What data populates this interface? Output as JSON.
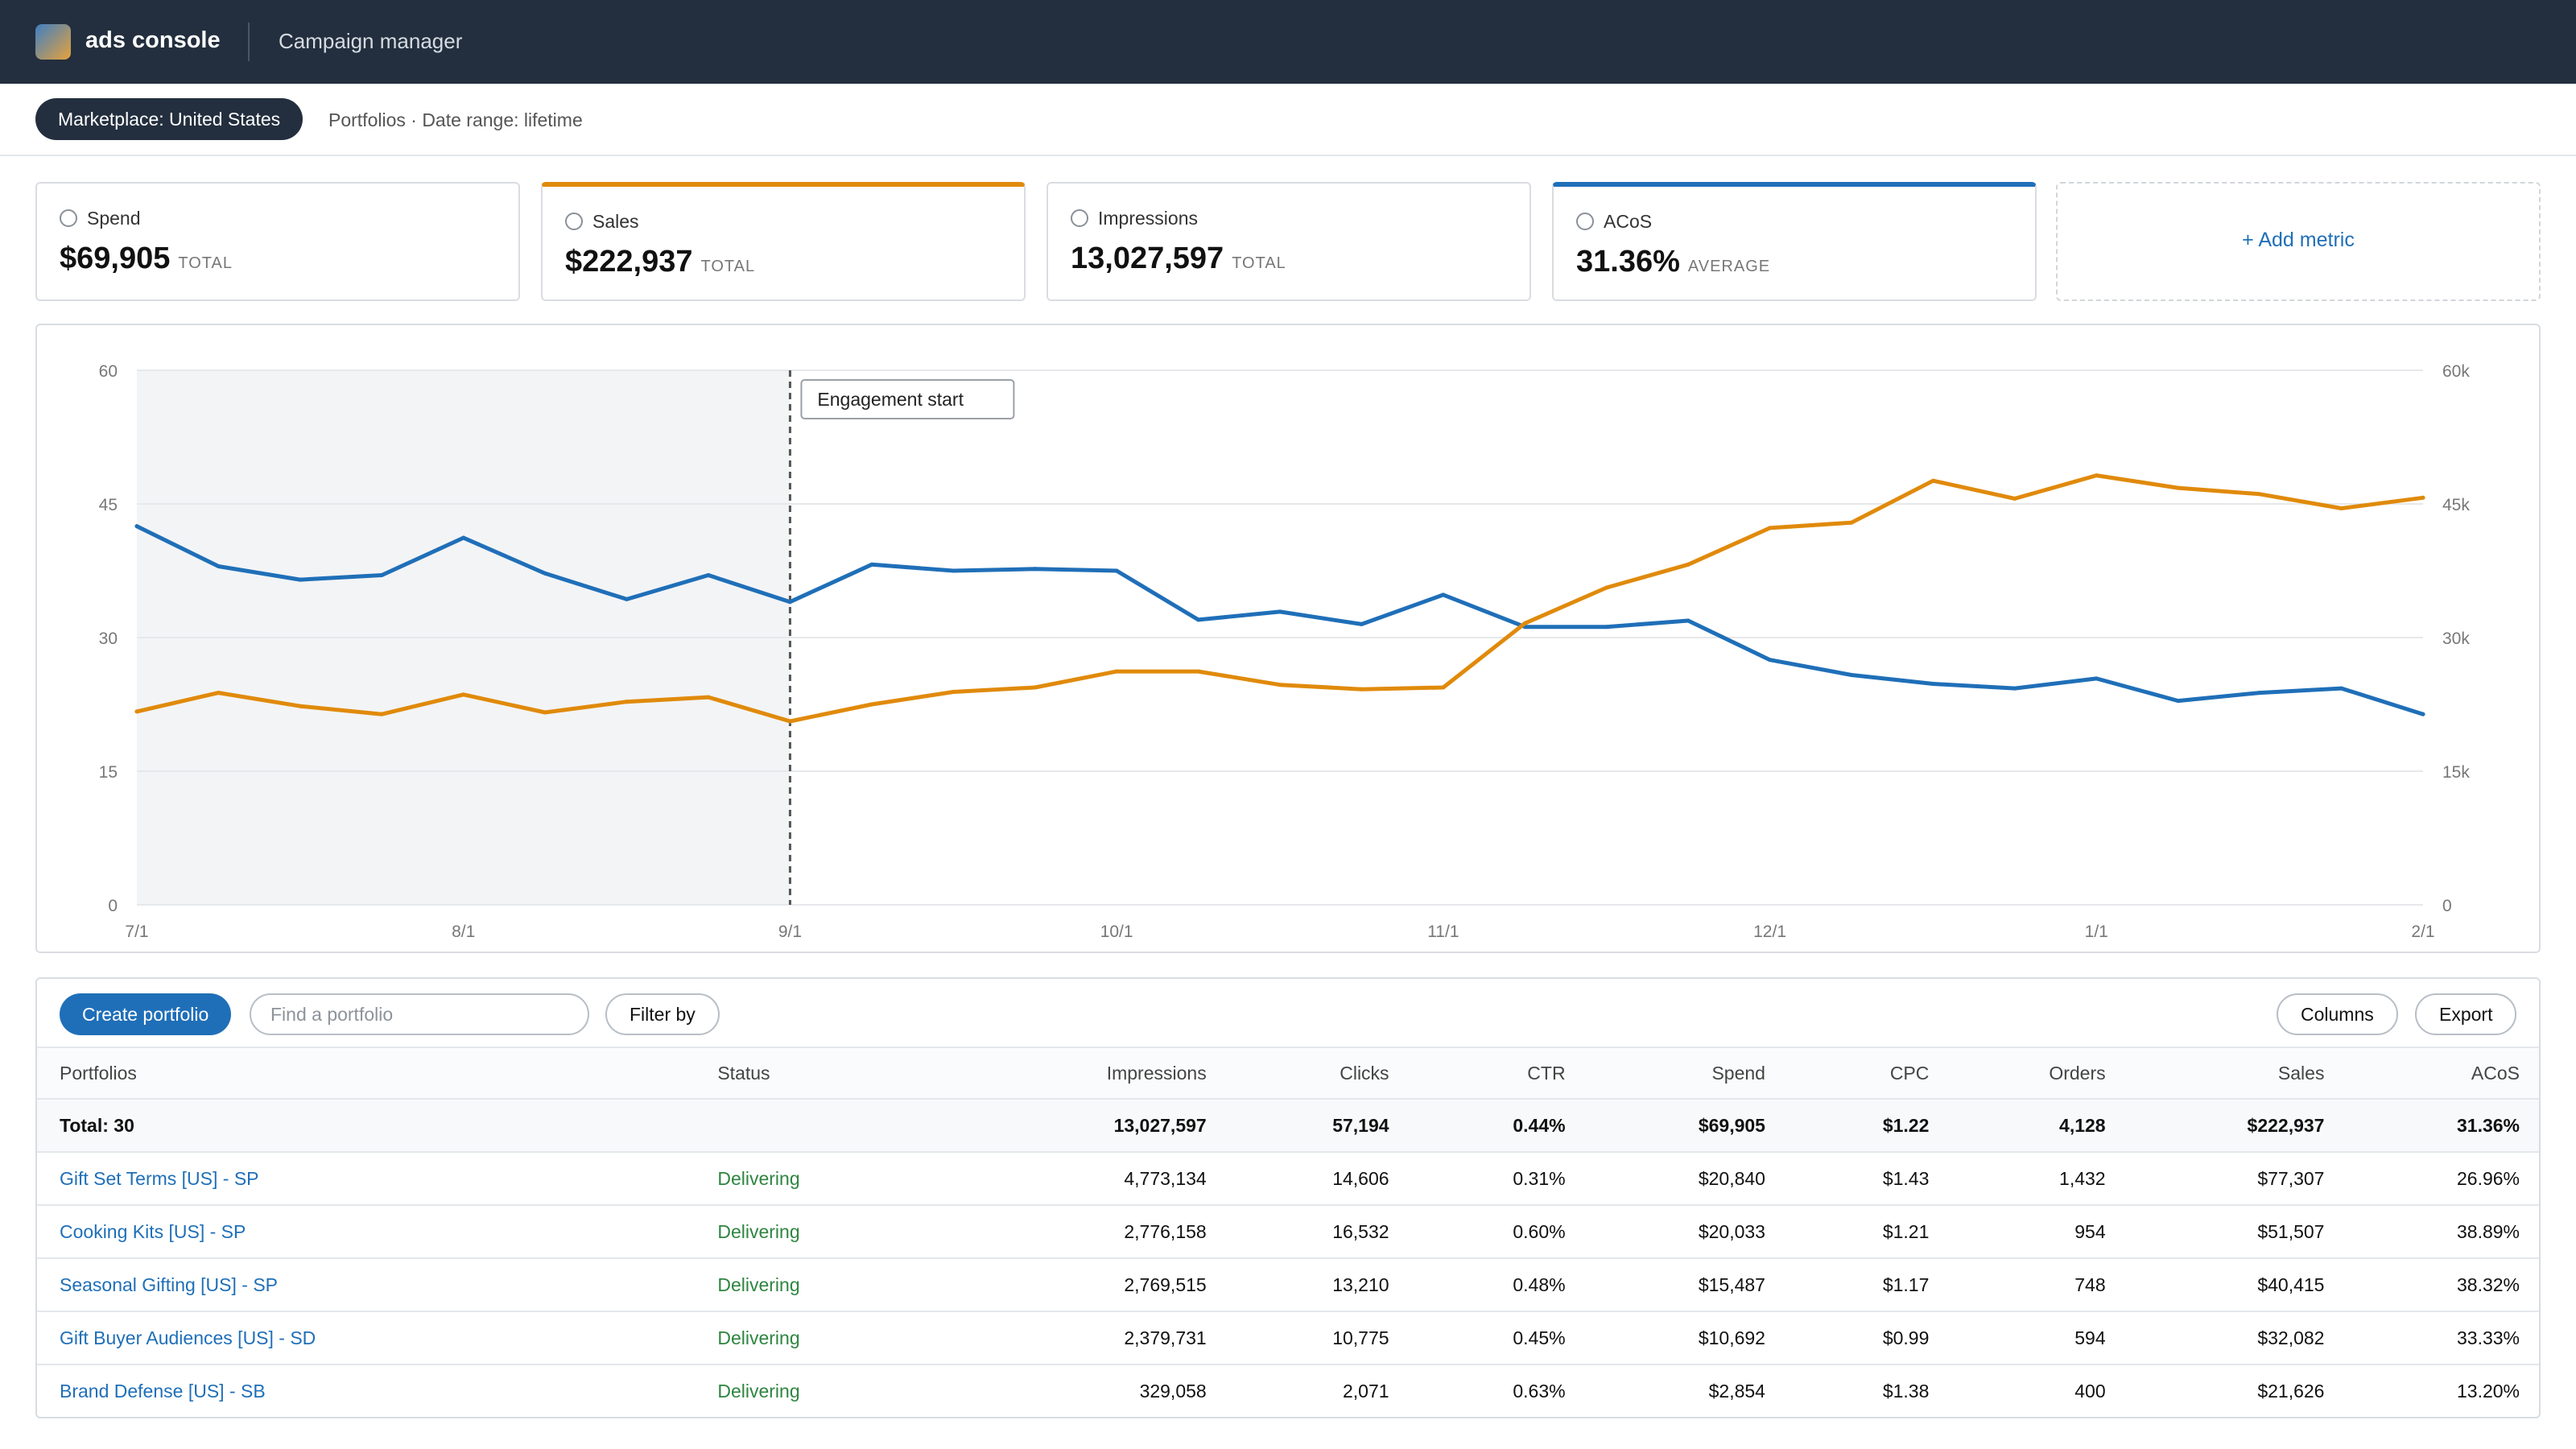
{
  "app": {
    "name": "ads console",
    "section": "Campaign manager"
  },
  "subbar": {
    "marketplace": "Marketplace: United States",
    "breadcrumb": "Portfolios · Date range: lifetime"
  },
  "metrics": [
    {
      "label": "Spend",
      "value": "$69,905",
      "suffix": "TOTAL"
    },
    {
      "label": "Sales",
      "value": "$222,937",
      "suffix": "TOTAL"
    },
    {
      "label": "Impressions",
      "value": "13,027,597",
      "suffix": "TOTAL"
    },
    {
      "label": "ACoS",
      "value": "31.36%",
      "suffix": "AVERAGE"
    }
  ],
  "add_metric": "+ Add metric",
  "colors": {
    "acos_line": "#1f6fb8",
    "sales_line": "#e08a0b",
    "topbar": "#232f3e"
  },
  "chart_data": {
    "type": "line",
    "annotation": "Engagement start",
    "annotation_x": "9/1",
    "shaded_range": [
      "7/1",
      "9/1"
    ],
    "xticks": [
      "7/1",
      "8/1",
      "9/1",
      "10/1",
      "11/1",
      "12/1",
      "1/1",
      "2/1"
    ],
    "x_points": 29,
    "left_axis": {
      "ticks": [
        "0",
        "15",
        "30",
        "45",
        "60"
      ],
      "ylim": [
        0,
        60
      ]
    },
    "right_axis": {
      "ticks": [
        "0",
        "15k",
        "30k",
        "45k",
        "60k"
      ],
      "ylim": [
        0,
        60000
      ]
    },
    "grid": true,
    "series": [
      {
        "axis": "left",
        "color": "#1f6fb8",
        "values": [
          42.5,
          38,
          36.5,
          37,
          41.2,
          37.2,
          34.3,
          37,
          34,
          38.2,
          37.5,
          37.7,
          37.5,
          32,
          32.9,
          31.5,
          34.8,
          31.2,
          31.2,
          31.9,
          27.5,
          25.8,
          24.8,
          24.3,
          25.4,
          22.9,
          23.8,
          24.3,
          21.4
        ]
      },
      {
        "axis": "right",
        "color": "#e08a0b",
        "values": [
          21700,
          23800,
          22300,
          21400,
          23600,
          21600,
          22800,
          23300,
          20600,
          22500,
          23900,
          24400,
          26200,
          26200,
          24700,
          24200,
          24400,
          31600,
          35600,
          38200,
          42300,
          42900,
          47600,
          45600,
          48200,
          46800,
          46100,
          44500,
          45700
        ]
      }
    ]
  },
  "toolbar": {
    "create": "Create portfolio",
    "search_placeholder": "Find a portfolio",
    "filter": "Filter by",
    "columns": "Columns",
    "export": "Export"
  },
  "table": {
    "headers": [
      "Portfolios",
      "Status",
      "Impressions",
      "Clicks",
      "CTR",
      "Spend",
      "CPC",
      "Orders",
      "Sales",
      "ACoS"
    ],
    "total": {
      "name": "Total: 30",
      "status": "",
      "impressions": "13,027,597",
      "clicks": "57,194",
      "ctr": "0.44%",
      "spend": "$69,905",
      "cpc": "$1.22",
      "orders": "4,128",
      "sales": "$222,937",
      "acos": "31.36%"
    },
    "rows": [
      {
        "name": "Gift Set Terms [US] - SP",
        "status": "Delivering",
        "impressions": "4,773,134",
        "clicks": "14,606",
        "ctr": "0.31%",
        "spend": "$20,840",
        "cpc": "$1.43",
        "orders": "1,432",
        "sales": "$77,307",
        "acos": "26.96%"
      },
      {
        "name": "Cooking Kits [US] - SP",
        "status": "Delivering",
        "impressions": "2,776,158",
        "clicks": "16,532",
        "ctr": "0.60%",
        "spend": "$20,033",
        "cpc": "$1.21",
        "orders": "954",
        "sales": "$51,507",
        "acos": "38.89%"
      },
      {
        "name": "Seasonal Gifting [US] - SP",
        "status": "Delivering",
        "impressions": "2,769,515",
        "clicks": "13,210",
        "ctr": "0.48%",
        "spend": "$15,487",
        "cpc": "$1.17",
        "orders": "748",
        "sales": "$40,415",
        "acos": "38.32%"
      },
      {
        "name": "Gift Buyer Audiences [US] - SD",
        "status": "Delivering",
        "impressions": "2,379,731",
        "clicks": "10,775",
        "ctr": "0.45%",
        "spend": "$10,692",
        "cpc": "$0.99",
        "orders": "594",
        "sales": "$32,082",
        "acos": "33.33%"
      },
      {
        "name": "Brand Defense [US] - SB",
        "status": "Delivering",
        "impressions": "329,058",
        "clicks": "2,071",
        "ctr": "0.63%",
        "spend": "$2,854",
        "cpc": "$1.38",
        "orders": "400",
        "sales": "$21,626",
        "acos": "13.20%"
      }
    ]
  }
}
